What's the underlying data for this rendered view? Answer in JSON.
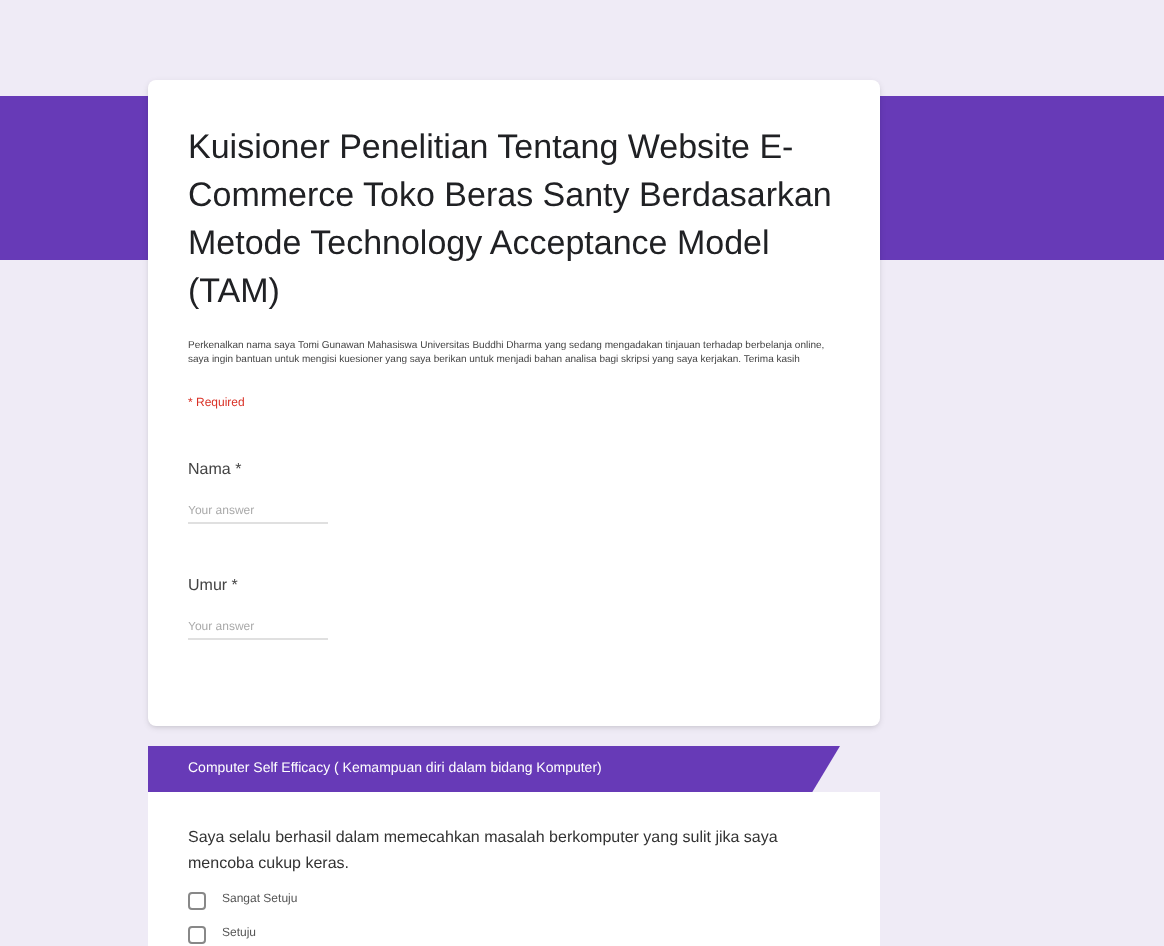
{
  "form": {
    "title": "Kuisioner Penelitian Tentang Website E-Commerce Toko Beras Santy Berdasarkan Metode Technology Acceptance Model (TAM)",
    "description": "Perkenalkan nama saya Tomi Gunawan Mahasiswa Universitas Buddhi Dharma yang sedang mengadakan tinjauan terhadap berbelanja online, saya ingin bantuan untuk mengisi kuesioner yang saya berikan untuk menjadi bahan analisa bagi skripsi yang saya kerjakan. Terima kasih",
    "required_note": "* Required"
  },
  "questions": [
    {
      "label": "Nama",
      "required_mark": "*",
      "placeholder": "Your answer"
    },
    {
      "label": "Umur",
      "required_mark": "*",
      "placeholder": "Your answer"
    }
  ],
  "section": {
    "title": "Computer Self Efficacy ( Kemampuan diri dalam bidang Komputer)",
    "question": "Saya selalu berhasil dalam memecahkan masalah berkomputer yang sulit jika saya mencoba cukup keras.",
    "options": [
      {
        "label": "Sangat Setuju",
        "checked": false
      },
      {
        "label": "Setuju",
        "checked": false
      }
    ]
  }
}
